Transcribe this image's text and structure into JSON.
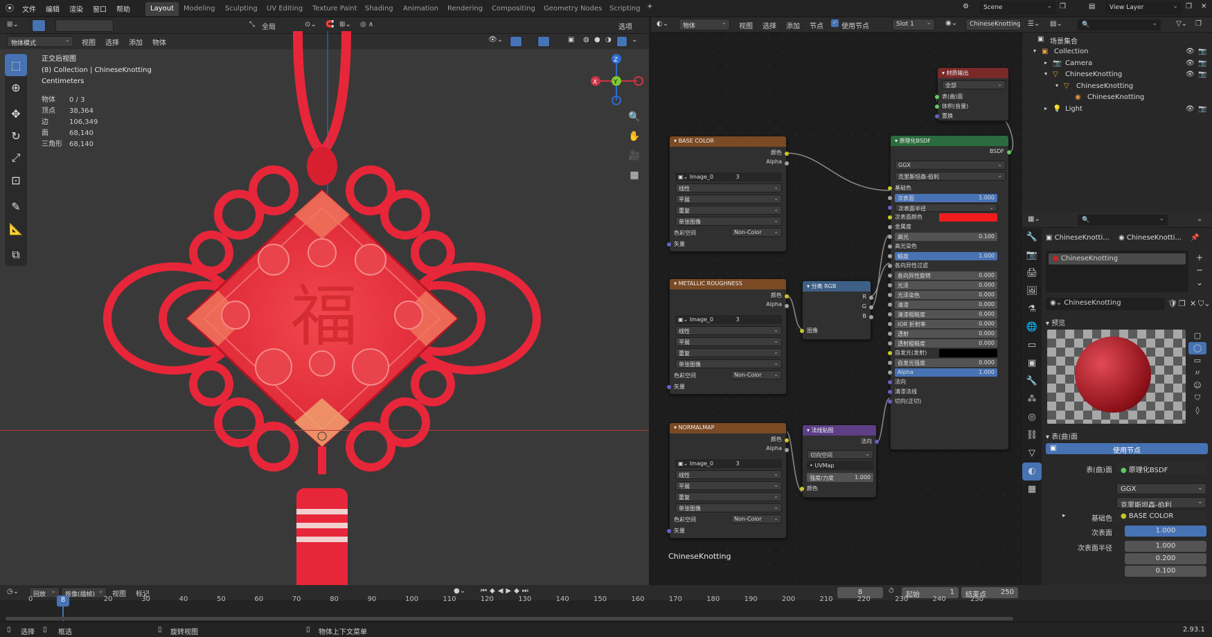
{
  "menu": [
    "文件",
    "编辑",
    "渲染",
    "窗口",
    "帮助"
  ],
  "workspaces": [
    "Layout",
    "Modeling",
    "Sculpting",
    "UV Editing",
    "Texture Paint",
    "Shading",
    "Animation",
    "Rendering",
    "Compositing",
    "Geometry Nodes",
    "Scripting"
  ],
  "scene": {
    "label": "Scene",
    "view_layer": "View Layer"
  },
  "viewport": {
    "mode": "物体模式",
    "menus": [
      "视图",
      "选择",
      "添加",
      "物体"
    ],
    "transform": "全局",
    "options": "选项",
    "overlay_title": "正交后视图",
    "overlay_collection": "(8) Collection | ChineseKnotting",
    "overlay_units": "Centimeters",
    "stats": [
      {
        "k": "物体",
        "v": "0 / 3"
      },
      {
        "k": "顶点",
        "v": "38,364"
      },
      {
        "k": "边",
        "v": "106,349"
      },
      {
        "k": "面",
        "v": "68,140"
      },
      {
        "k": "三角形",
        "v": "68,140"
      }
    ],
    "gizmo": {
      "x": "X",
      "y": "Y",
      "z": "Z"
    },
    "fu_char": "福"
  },
  "node_editor": {
    "type_label": "物体",
    "menus": [
      "视图",
      "选择",
      "添加",
      "节点"
    ],
    "use_nodes": "使用节点",
    "slot": "Slot 1",
    "material": "ChineseKnotting",
    "footer": "ChineseKnotting",
    "nodes": {
      "base": {
        "title": "BASE COLOR",
        "out1": "颜色",
        "out2": "Alpha",
        "image": "Image_0",
        "num": "3",
        "f1": "线性",
        "f2": "平展",
        "f3": "重复",
        "f4": "单张图像",
        "cs_label": "色彩空间",
        "cs": "Non-Color",
        "vec": "矢量"
      },
      "metal": {
        "title": "METALLIC ROUGHNESS",
        "out1": "颜色",
        "out2": "Alpha",
        "image": "Image_0",
        "num": "3",
        "f1": "线性",
        "f2": "平展",
        "f3": "重复",
        "f4": "单张图像",
        "cs_label": "色彩空间",
        "cs": "Non-Color",
        "vec": "矢量"
      },
      "normal": {
        "title": "NORMALMAP",
        "out1": "颜色",
        "out2": "Alpha",
        "image": "Image_0",
        "num": "3",
        "f1": "线性",
        "f2": "平展",
        "f3": "重复",
        "f4": "单张图像",
        "cs_label": "色彩空间",
        "cs": "Non-Color",
        "vec": "矢量"
      },
      "sep": {
        "title": "分离 RGB",
        "r": "R",
        "g": "G",
        "b": "B",
        "in": "图像"
      },
      "nmap": {
        "title": "法线贴图",
        "out": "法向",
        "space": "切向空间",
        "uv": "UVMap",
        "strength": "强度/力度",
        "strength_v": "1.000",
        "col": "颜色"
      },
      "out": {
        "title": "材质输出",
        "target": "全部",
        "s1": "表(曲)面",
        "s2": "体积(音量)",
        "s3": "置换"
      },
      "bsdf": {
        "title": "原理化BSDF",
        "bsdf": "BSDF",
        "dist": "GGX",
        "sss": "克里斯坦森-伯利",
        "rows": [
          {
            "l": "基础色",
            "v": ""
          },
          {
            "l": "次表面",
            "v": "1.000"
          },
          {
            "l": "次表面半径",
            "v": ""
          },
          {
            "l": "次表面颜色",
            "v": ""
          },
          {
            "l": "金属度",
            "v": ""
          },
          {
            "l": "高光",
            "v": "0.100"
          },
          {
            "l": "高光染色",
            "v": ""
          },
          {
            "l": "糙度",
            "v": "1.000"
          },
          {
            "l": "各向异性过滤",
            "v": ""
          },
          {
            "l": "各向异性旋转",
            "v": "0.000"
          },
          {
            "l": "光泽",
            "v": "0.000"
          },
          {
            "l": "光泽染色",
            "v": "0.000"
          },
          {
            "l": "清漆",
            "v": "0.000"
          },
          {
            "l": "清漆粗糙度",
            "v": "0.000"
          },
          {
            "l": "IOR 折射率",
            "v": "0.000"
          },
          {
            "l": "透射",
            "v": "0.000"
          },
          {
            "l": "透射粗糙度",
            "v": "0.000"
          },
          {
            "l": "自发光(发射)",
            "v": ""
          },
          {
            "l": "自发光强度",
            "v": "0.000"
          },
          {
            "l": "Alpha",
            "v": "1.000"
          },
          {
            "l": "法向",
            "v": ""
          },
          {
            "l": "清漆法线",
            "v": ""
          },
          {
            "l": "切向(正切)",
            "v": ""
          }
        ]
      }
    }
  },
  "outliner": {
    "root": "场景集合",
    "items": [
      {
        "label": "Collection",
        "indent": 1
      },
      {
        "label": "Camera",
        "indent": 2
      },
      {
        "label": "ChineseKnotting",
        "indent": 2
      },
      {
        "label": "ChineseKnotting",
        "indent": 3
      },
      {
        "label": "ChineseKnotting",
        "indent": 4
      },
      {
        "label": "Light",
        "indent": 2
      }
    ]
  },
  "properties": {
    "crumb1": "ChineseKnotti...",
    "crumb2": "ChineseKnotti...",
    "slot_material": "ChineseKnotting",
    "material_name": "ChineseKnotting",
    "preview": "预览",
    "surface_panel": "表(曲)面",
    "use_nodes": "使用节点",
    "surface_label": "表(曲)面",
    "surface_value": "原理化BSDF",
    "dist": "GGX",
    "sss": "克里斯坦森-伯利",
    "base_label": "基础色",
    "base_value": "BASE COLOR",
    "sub_label": "次表面",
    "sub_value": "1.000",
    "subr_label": "次表面半径",
    "subr_values": [
      "1.000",
      "0.200",
      "0.100"
    ]
  },
  "timeline": {
    "menus": [
      "回放",
      "抠像(插帧)",
      "视图",
      "标记"
    ],
    "current": "8",
    "start_label": "起始",
    "start": "1",
    "end_label": "结束点",
    "end": "250",
    "ticks": [
      "0",
      "8",
      "20",
      "30",
      "40",
      "50",
      "60",
      "70",
      "80",
      "90",
      "100",
      "110",
      "120",
      "130",
      "140",
      "150",
      "160",
      "170",
      "180",
      "190",
      "200",
      "210",
      "220",
      "230",
      "240",
      "250"
    ]
  },
  "status": {
    "select": "选择",
    "box": "框选",
    "rotate": "旋转视图",
    "context": "物体上下文菜单",
    "version": "2.93.1"
  },
  "colors": {
    "accent": "#4772b3",
    "knot": "#e8263a",
    "emission": "#000000",
    "base_color_swatch": "#ee1c1c"
  }
}
